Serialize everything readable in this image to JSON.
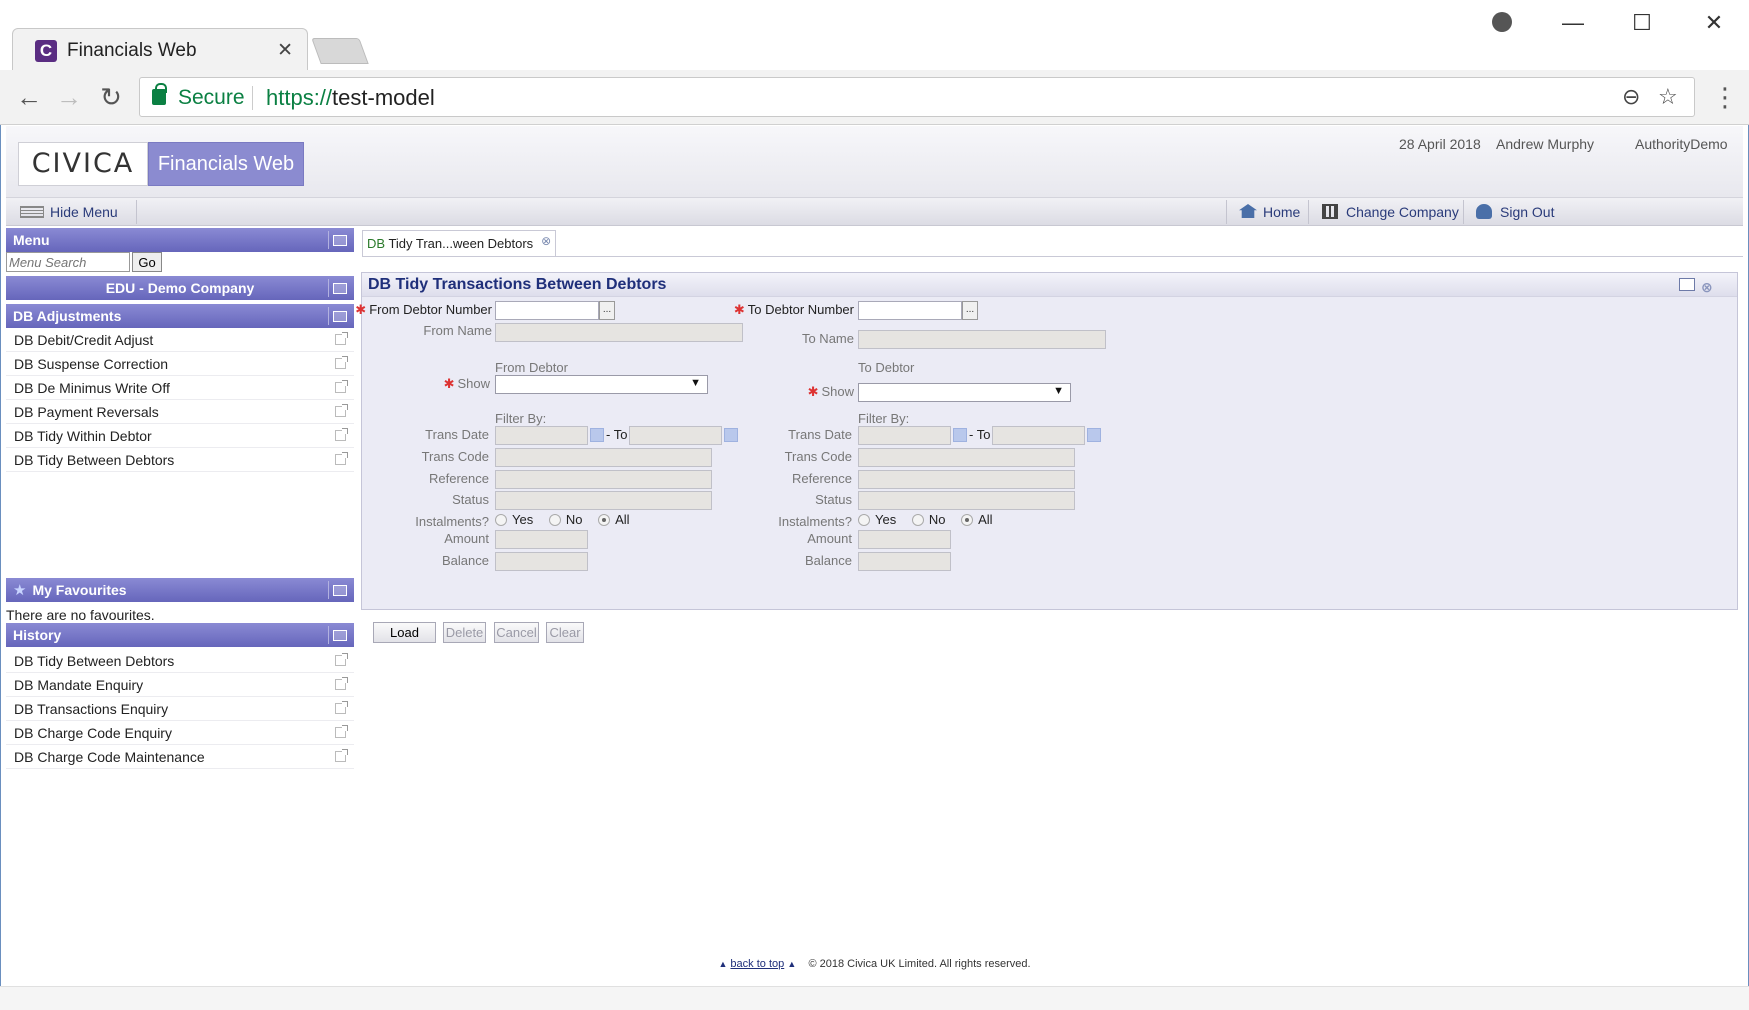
{
  "browser": {
    "tab_title": "Financials Web",
    "tab_close": "✕",
    "favicon_letter": "C",
    "secure_label": "Secure",
    "url_scheme": "https://",
    "url_host": "test-model"
  },
  "header": {
    "logo": "CIVICA",
    "product": "Financials Web",
    "date": "28 April 2018",
    "user": "Andrew Murphy",
    "company": "AuthorityDemo"
  },
  "appbar": {
    "hide_menu": "Hide Menu",
    "home": "Home",
    "change_company": "Change Company",
    "sign_out": "Sign Out"
  },
  "sidebar": {
    "menu_title": "Menu",
    "search_placeholder": "Menu Search",
    "go_label": "Go",
    "company_title": "EDU - Demo Company",
    "adjustments_title": "DB Adjustments",
    "adjustments": [
      "DB Debit/Credit Adjust",
      "DB Suspense Correction",
      "DB De Minimus Write Off",
      "DB Payment Reversals",
      "DB Tidy Within Debtor",
      "DB Tidy Between Debtors"
    ],
    "favourites_title": "My Favourites",
    "no_favourites": "There are no favourites.",
    "history_title": "History",
    "history": [
      "DB Tidy Between Debtors",
      "DB Mandate Enquiry",
      "DB Transactions Enquiry",
      "DB Charge Code Enquiry",
      "DB Charge Code Maintenance"
    ]
  },
  "content": {
    "tab_prefix": "DB",
    "tab_label": " Tidy Tran...ween Debtors",
    "form_title": "DB Tidy Transactions Between Debtors",
    "from": {
      "debtor_number": "From Debtor Number",
      "name": "From Name",
      "section": "From Debtor",
      "show": "Show",
      "filter_by": "Filter By:",
      "trans_date": "Trans Date",
      "to": "- To",
      "trans_code": "Trans Code",
      "reference": "Reference",
      "status": "Status",
      "instalments": "Instalments?",
      "yes": "Yes",
      "no": "No",
      "all": "All",
      "amount": "Amount",
      "balance": "Balance"
    },
    "to": {
      "debtor_number": "To Debtor Number",
      "name": "To Name",
      "section": "To Debtor",
      "show": "Show",
      "filter_by": "Filter By:",
      "trans_date": "Trans Date",
      "to": "- To",
      "trans_code": "Trans Code",
      "reference": "Reference",
      "status": "Status",
      "instalments": "Instalments?",
      "yes": "Yes",
      "no": "No",
      "all": "All",
      "amount": "Amount",
      "balance": "Balance"
    },
    "dots": "...",
    "buttons": {
      "load": "Load",
      "delete": "Delete",
      "cancel": "Cancel",
      "clear": "Clear"
    }
  },
  "footer": {
    "back_to_top": "back to top",
    "copyright": "© 2018 Civica UK Limited. All rights reserved."
  }
}
